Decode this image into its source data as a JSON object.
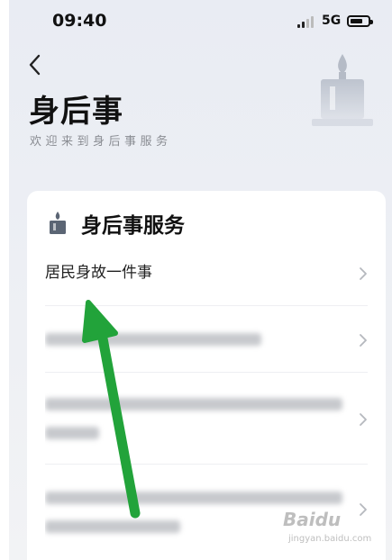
{
  "status_bar": {
    "time": "09:40",
    "network": "5G",
    "battery_level": 0.7
  },
  "header": {
    "back_icon": "chevron-left-icon",
    "title": "身后事",
    "subtitle": "欢迎来到身后事服务",
    "hero_icon": "candle-icon"
  },
  "card": {
    "icon": "candle-icon",
    "title": "身后事服务",
    "items": [
      {
        "label": "居民身故一件事",
        "blurred": false
      },
      {
        "label": "",
        "blurred": true
      },
      {
        "label": "",
        "blurred": true
      },
      {
        "label": "",
        "blurred": true
      }
    ]
  },
  "overlay": {
    "arrow_color": "#22a33a"
  },
  "watermark": {
    "brand": "Baidu",
    "site": "jingyan.baidu.com"
  }
}
